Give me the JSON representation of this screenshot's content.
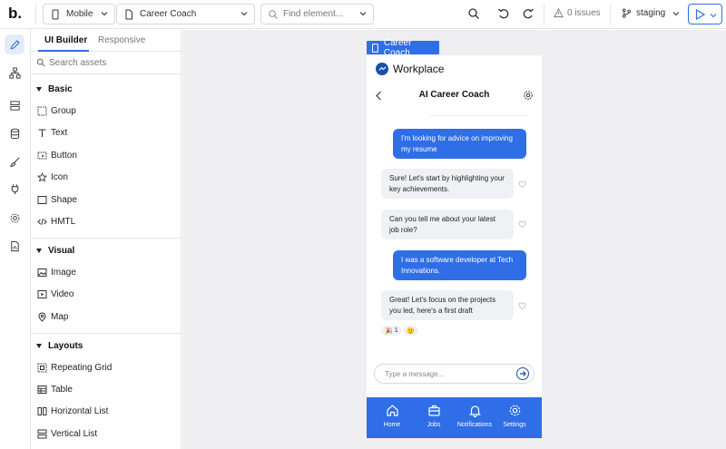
{
  "app": {
    "logo_text": "b"
  },
  "toolbar": {
    "device": "Mobile",
    "page": "Career Coach",
    "find_placeholder": "Find element...",
    "issues": "0 issues",
    "branch": "staging"
  },
  "panel": {
    "tabs": [
      {
        "label": "UI Builder"
      },
      {
        "label": "Responsive"
      }
    ],
    "search_placeholder": "Search assets",
    "sections": [
      {
        "label": "Basic",
        "items": [
          {
            "label": "Group",
            "icon": "group-icon"
          },
          {
            "label": "Text",
            "icon": "text-icon"
          },
          {
            "label": "Button",
            "icon": "button-icon"
          },
          {
            "label": "Icon",
            "icon": "star-icon"
          },
          {
            "label": "Shape",
            "icon": "shape-icon"
          },
          {
            "label": "HMTL",
            "icon": "code-icon"
          }
        ]
      },
      {
        "label": "Visual",
        "items": [
          {
            "label": "Image",
            "icon": "image-icon"
          },
          {
            "label": "Video",
            "icon": "video-icon"
          },
          {
            "label": "Map",
            "icon": "map-pin-icon"
          }
        ]
      },
      {
        "label": "Layouts",
        "items": [
          {
            "label": "Repeating Grid",
            "icon": "repeating-grid-icon"
          },
          {
            "label": "Table",
            "icon": "table-icon"
          },
          {
            "label": "Horizontal List",
            "icon": "horizontal-list-icon"
          },
          {
            "label": "Vertical List",
            "icon": "vertical-list-icon"
          }
        ]
      }
    ]
  },
  "canvas": {
    "frame_label": "Career Coach",
    "phone": {
      "brand": "Workplace",
      "title": "AI Career Coach",
      "messages": [
        {
          "role": "user",
          "text": "I'm looking for advice on improving my resume"
        },
        {
          "role": "bot",
          "text": "Sure! Let's start by highlighting your key achievements."
        },
        {
          "role": "bot",
          "text": "Can you tell me about your latest job role?"
        },
        {
          "role": "user",
          "text": "I was a software developer at Tech Innovations."
        },
        {
          "role": "bot",
          "text": "Great! Let's focus on the projects you led, here's a first draft"
        }
      ],
      "reactions": [
        {
          "emoji": "🎉",
          "count": "1"
        },
        {
          "emoji": "🙂",
          "count": ""
        }
      ],
      "composer_placeholder": "Type a message...",
      "nav": [
        {
          "label": "Home",
          "icon": "home-icon"
        },
        {
          "label": "Jobs",
          "icon": "briefcase-icon"
        },
        {
          "label": "Notifications",
          "icon": "bell-icon"
        },
        {
          "label": "Settings",
          "icon": "gear-icon"
        }
      ]
    }
  },
  "colors": {
    "accent": "#2f6ee6",
    "brand_dark": "#1d4fa8",
    "canvas_bg": "#efeff1",
    "bubble_bot": "#f0f1f4"
  }
}
